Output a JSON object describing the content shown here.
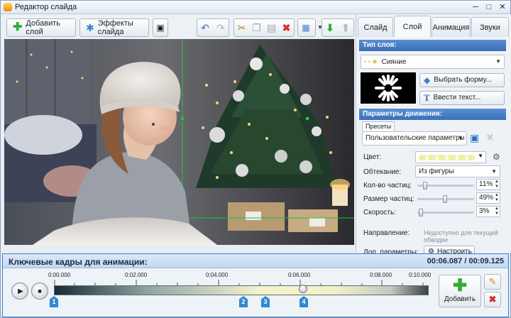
{
  "window": {
    "title": "Редактор слайда"
  },
  "toolbar": {
    "add_layer_label": "Добавить слой",
    "slide_effects_label": "Эффекты слайда"
  },
  "panel": {
    "tabs": [
      "Слайд",
      "Слой",
      "Анимация",
      "Звуки"
    ],
    "active_tab": "Слой",
    "layer_type": {
      "header": "Тип слоя:",
      "selected": "Сияние",
      "choose_shape_label": "Выбрать форму...",
      "enter_text_label": "Ввести текст..."
    },
    "motion": {
      "header": "Параметры движения:",
      "presets_tab": "Пресеты",
      "preset_selected": "Пользовательские параметры",
      "color_label": "Цвет:",
      "flow_label": "Обтекание:",
      "flow_value": "Из фигуры",
      "count_label": "Кол-во частиц:",
      "count_value": "11%",
      "count_level": 0.11,
      "size_label": "Размер частиц:",
      "size_value": "49%",
      "size_level": 0.49,
      "speed_label": "Скорость:",
      "speed_value": "3%",
      "speed_level": 0.03,
      "direction_label": "Направление:",
      "direction_value": "Недоступно для текущей обводки",
      "extra_label": "Доп. параметры:",
      "configure_label": "Настроить"
    }
  },
  "timeline": {
    "title": "Ключевые кадры для анимации:",
    "time": "00:06.087 / 00:09.125",
    "ruler": [
      "0:00.000",
      "0:02.000",
      "0:04.000",
      "0:06.000",
      "0:08.000",
      "0:10.000"
    ],
    "keyframes": [
      "1",
      "2",
      "3",
      "4"
    ],
    "add_label": "Добавить"
  },
  "colors": {
    "accent": "#3a6fb7",
    "keyframe": "#2f8ad0",
    "add_green": "#2fae2f",
    "delete_red": "#d9302a"
  }
}
